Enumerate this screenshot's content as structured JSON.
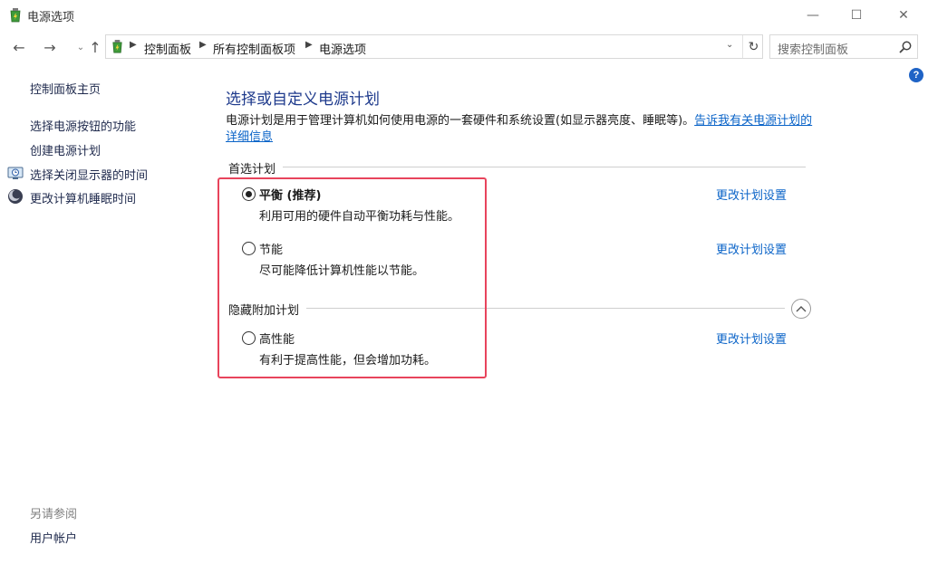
{
  "window": {
    "title": "电源选项",
    "minimize": "—",
    "maximize": "☐",
    "close": "✕"
  },
  "nav": {
    "back": "←",
    "forward": "→",
    "recent": "⌄",
    "up": "↑"
  },
  "address": {
    "crumbs": [
      "控制面板",
      "所有控制面板项",
      "电源选项"
    ],
    "refresh": "↻",
    "dropdown": "⌄"
  },
  "search": {
    "placeholder": "搜索控制面板"
  },
  "help": "?",
  "sidebar": {
    "home": "控制面板主页",
    "items": [
      {
        "label": "选择电源按钮的功能",
        "icon": null
      },
      {
        "label": "创建电源计划",
        "icon": null
      },
      {
        "label": "选择关闭显示器的时间",
        "icon": "monitor-clock-icon"
      },
      {
        "label": "更改计算机睡眠时间",
        "icon": "moon-icon"
      }
    ],
    "see_also": "另请参阅",
    "user_accounts": "用户帐户"
  },
  "main": {
    "title": "选择或自定义电源计划",
    "description": "电源计划是用于管理计算机如何使用电源的一套硬件和系统设置(如显示器亮度、睡眠等)。",
    "description_link": "告诉我有关电源计划的详细信息",
    "preferred_label": "首选计划",
    "hidden_label": "隐藏附加计划",
    "plans": [
      {
        "name": "平衡 (推荐)",
        "desc": "利用可用的硬件自动平衡功耗与性能。",
        "selected": true,
        "link": "更改计划设置"
      },
      {
        "name": "节能",
        "desc": "尽可能降低计算机性能以节能。",
        "selected": false,
        "link": "更改计划设置"
      },
      {
        "name": "高性能",
        "desc": "有利于提高性能，但会增加功耗。",
        "selected": false,
        "link": "更改计划设置"
      }
    ]
  },
  "colors": {
    "link": "#0b64c8",
    "title": "#1e3a8c",
    "highlight": "#e8445c"
  }
}
